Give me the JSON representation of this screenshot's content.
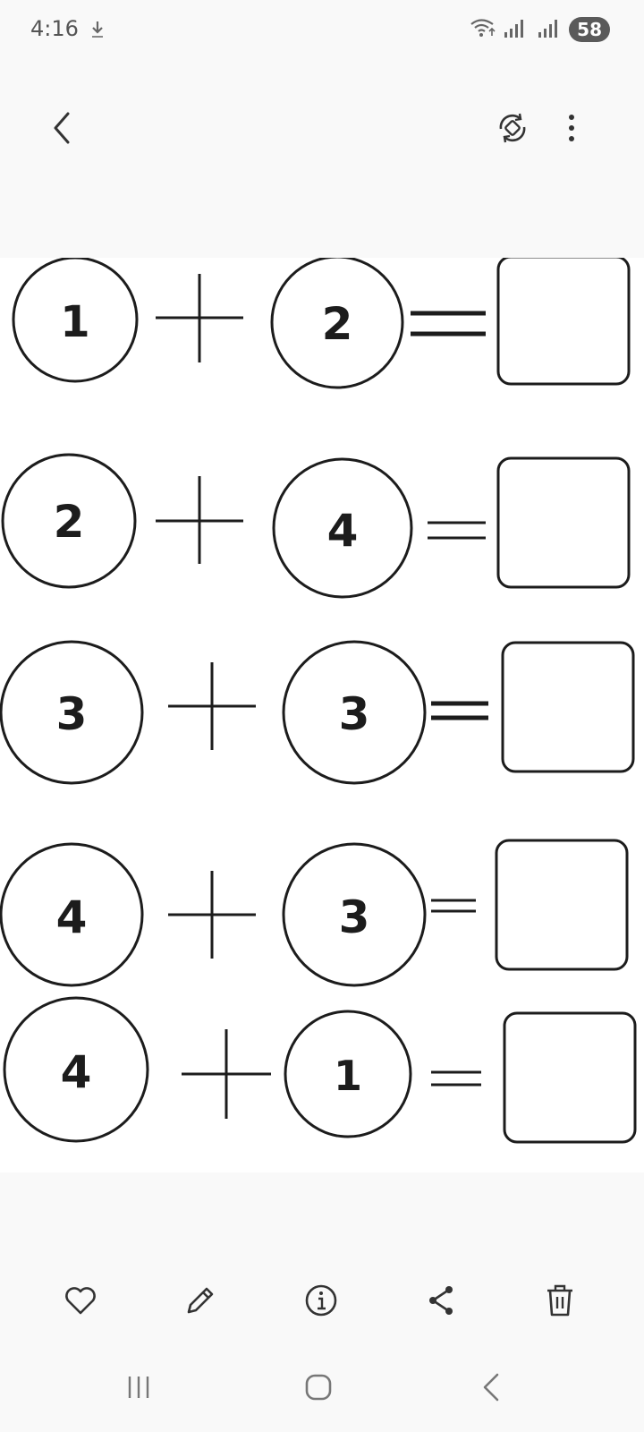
{
  "status_bar": {
    "time": "4:16",
    "battery": "58"
  },
  "top_bar": {
    "back_icon": "chevron-left-icon",
    "rotate_icon": "auto-rotate-icon",
    "more_icon": "more-vertical-icon"
  },
  "image": {
    "rows": [
      {
        "left": "1",
        "operator": "+",
        "right": "2",
        "equals": "=",
        "answer": ""
      },
      {
        "left": "2",
        "operator": "+",
        "right": "4",
        "equals": "=",
        "answer": ""
      },
      {
        "left": "3",
        "operator": "+",
        "right": "3",
        "equals": "=",
        "answer": ""
      },
      {
        "left": "4",
        "operator": "+",
        "right": "3",
        "equals": "=",
        "answer": ""
      },
      {
        "left": "4",
        "operator": "+",
        "right": "1",
        "equals": "=",
        "answer": ""
      }
    ]
  },
  "bottom_toolbar": {
    "items": [
      {
        "name": "favorite",
        "icon": "heart-icon"
      },
      {
        "name": "edit",
        "icon": "pencil-icon"
      },
      {
        "name": "details",
        "icon": "info-icon"
      },
      {
        "name": "share",
        "icon": "share-icon"
      },
      {
        "name": "delete",
        "icon": "trash-icon"
      }
    ]
  },
  "nav_bar": {
    "recents_icon": "recents-icon",
    "home_icon": "home-icon",
    "back_icon": "back-icon"
  },
  "colors": {
    "background": "#f9f9f9",
    "ink": "#1c1c1c",
    "icon": "#333333"
  }
}
